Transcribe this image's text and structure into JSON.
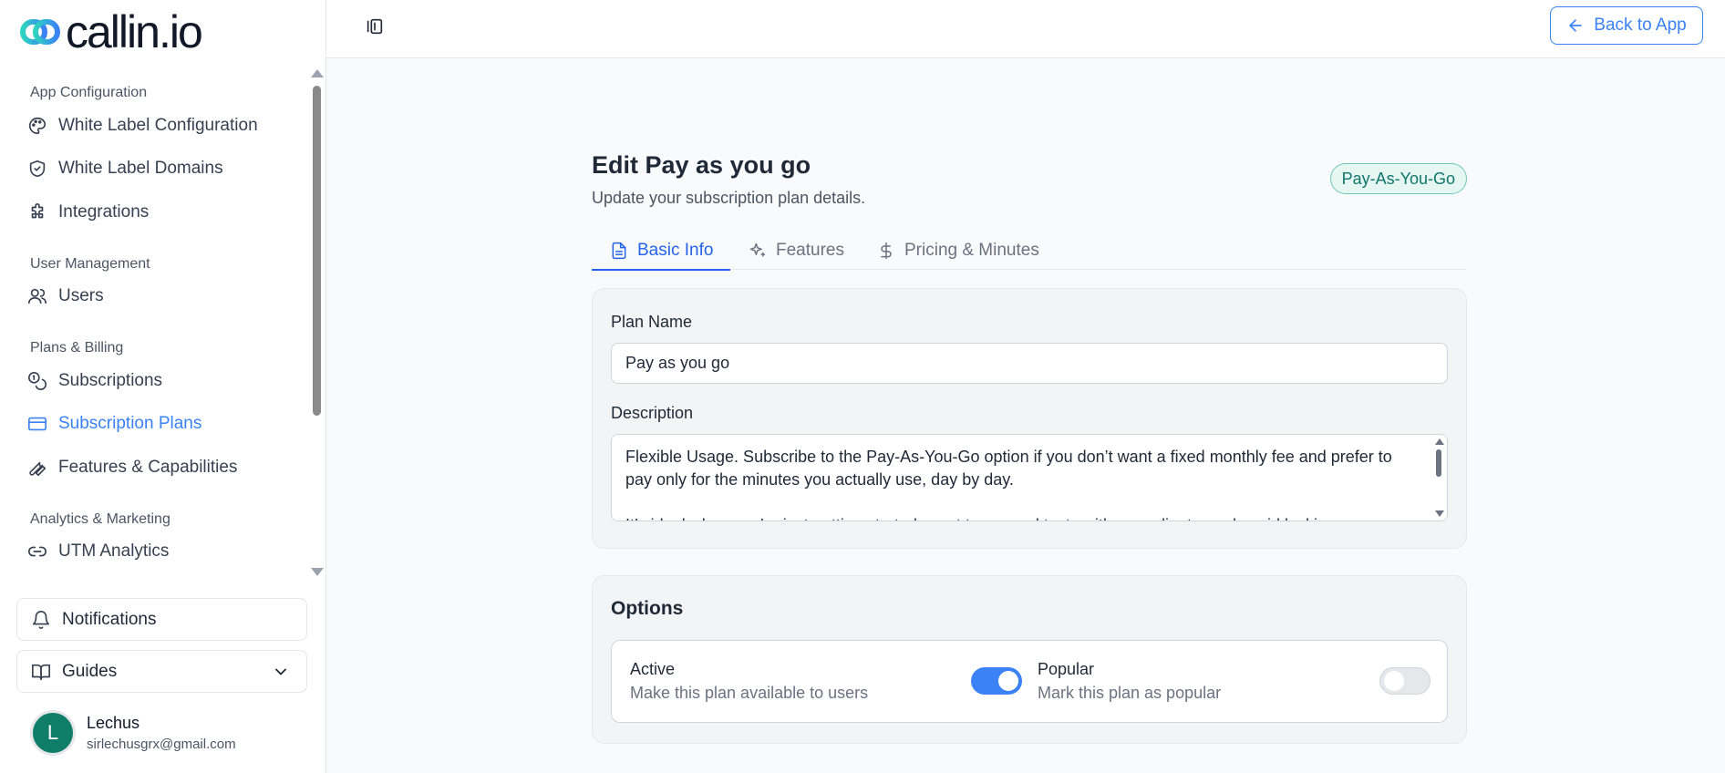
{
  "brand": {
    "name": "callin.io",
    "accent": "#3b82f6",
    "logo_gradient": [
      "#2dd4bf",
      "#3b82f6"
    ]
  },
  "sidebar": {
    "sections": [
      {
        "label": "App Configuration",
        "items": [
          {
            "label": "White Label Configuration",
            "icon": "palette-icon"
          },
          {
            "label": "White Label Domains",
            "icon": "shield-check-icon"
          },
          {
            "label": "Integrations",
            "icon": "puzzle-icon"
          }
        ]
      },
      {
        "label": "User Management",
        "items": [
          {
            "label": "Users",
            "icon": "users-icon"
          }
        ]
      },
      {
        "label": "Plans & Billing",
        "items": [
          {
            "label": "Subscriptions",
            "icon": "coins-icon"
          },
          {
            "label": "Subscription Plans",
            "icon": "credit-card-icon",
            "active": true
          },
          {
            "label": "Features & Capabilities",
            "icon": "wrench-icon"
          }
        ]
      },
      {
        "label": "Analytics & Marketing",
        "items": [
          {
            "label": "UTM Analytics",
            "icon": "link-icon"
          }
        ]
      }
    ],
    "notifications_label": "Notifications",
    "guides_label": "Guides",
    "user": {
      "initial": "L",
      "name": "Lechus",
      "email": "sirlechusgrx@gmail.com",
      "avatar_color": "#0f7d67"
    }
  },
  "topbar": {
    "back_label": "Back to App"
  },
  "page": {
    "title": "Edit Pay as you go",
    "subtitle": "Update your subscription plan details.",
    "badge": "Pay-As-You-Go",
    "tabs": [
      {
        "label": "Basic Info",
        "icon": "file-text-icon",
        "active": true
      },
      {
        "label": "Features",
        "icon": "sparkles-icon"
      },
      {
        "label": "Pricing & Minutes",
        "icon": "dollar-icon"
      }
    ]
  },
  "form": {
    "plan_name_label": "Plan Name",
    "plan_name_value": "Pay as you go",
    "description_label": "Description",
    "description_lines": [
      "Flexible Usage. Subscribe to the Pay-As-You-Go option if you don’t want a fixed monthly fee and prefer to pay only for the minutes you actually use, day by day.",
      "It’s ideal when you’re just getting started, want to run real tests with your clients, and avoid locking"
    ]
  },
  "options": {
    "title": "Options",
    "active": {
      "label": "Active",
      "desc": "Make this plan available to users",
      "on": true
    },
    "popular": {
      "label": "Popular",
      "desc": "Mark this plan as popular",
      "on": false
    }
  }
}
